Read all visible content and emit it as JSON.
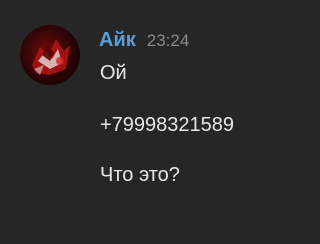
{
  "message": {
    "author": "Айк",
    "author_color": "#5b9fd6",
    "timestamp": "23:24",
    "avatar_icon": "red-dark-abstract-avatar",
    "lines": [
      "Ой",
      "+79998321589",
      "Что это?"
    ]
  },
  "colors": {
    "background": "#262626",
    "text": "#e6e6e6",
    "timestamp": "#8a8a8a"
  }
}
